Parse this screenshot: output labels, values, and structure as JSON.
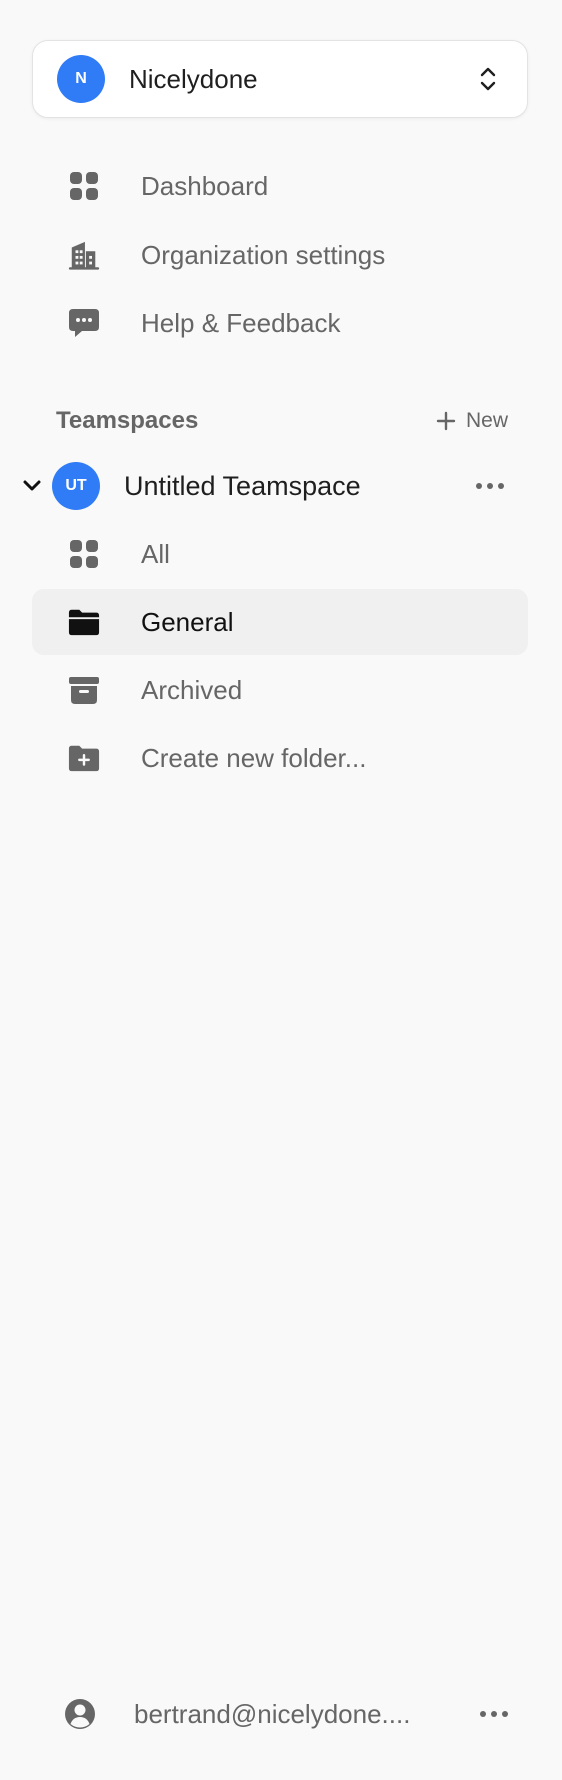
{
  "org": {
    "initial": "N",
    "name": "Nicelydone",
    "avatar_color": "#2f7cf6",
    "switch_icon": "chevron-up-down-icon"
  },
  "nav": {
    "items": [
      {
        "label": "Dashboard",
        "icon": "grid-icon"
      },
      {
        "label": "Organization settings",
        "icon": "building-icon"
      },
      {
        "label": "Help & Feedback",
        "icon": "chat-bubble-icon"
      }
    ]
  },
  "teamspaces": {
    "title": "Teamspaces",
    "new_label": "New",
    "team": {
      "initials": "UT",
      "name": "Untitled Teamspace",
      "expanded": true,
      "items": [
        {
          "label": "All",
          "icon": "grid-icon",
          "selected": false
        },
        {
          "label": "General",
          "icon": "folder-icon",
          "selected": true
        },
        {
          "label": "Archived",
          "icon": "archive-icon",
          "selected": false
        },
        {
          "label": "Create new folder...",
          "icon": "folder-plus-icon",
          "selected": false
        }
      ]
    }
  },
  "footer": {
    "email": "bertrand@nicelydone....",
    "icon": "user-circle-icon"
  },
  "colors": {
    "background": "#f9f9f9",
    "accent": "#2f7cf6",
    "selected_bg": "#f0f0f0",
    "text_muted": "#666666",
    "text_strong": "#1f1f1f"
  }
}
